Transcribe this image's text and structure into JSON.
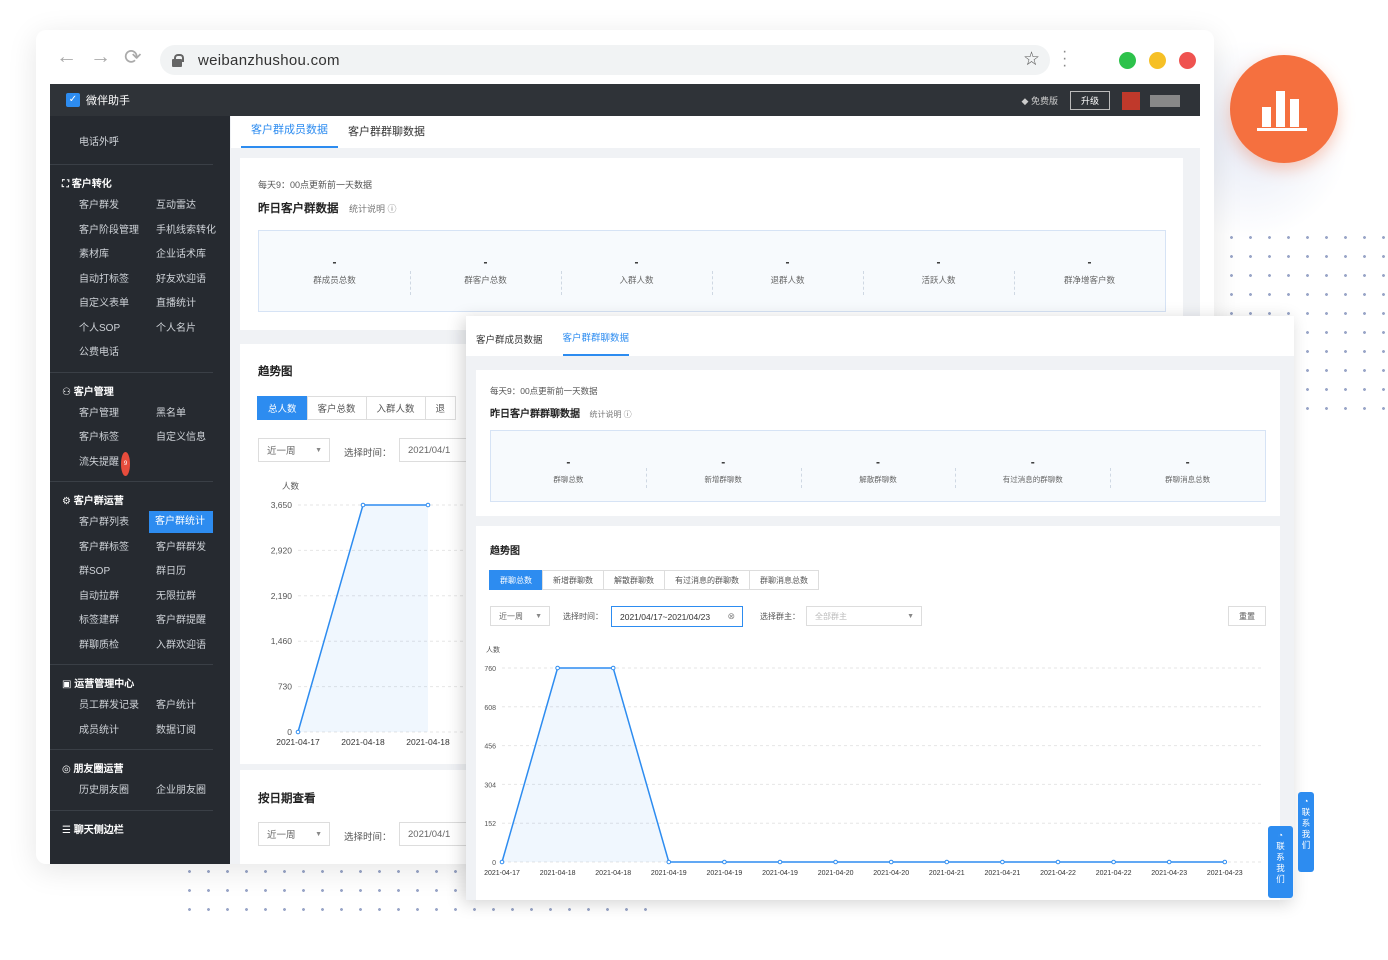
{
  "browser": {
    "url": "weibanzhushou.com",
    "nav_back": "←",
    "nav_forward": "→",
    "nav_reload": "⟳",
    "star": "☆"
  },
  "app": {
    "brand": "微伴助手",
    "free_label": "免费版",
    "upgrade_label": "升级"
  },
  "sidebar": {
    "top_item": "电话外呼",
    "sections": [
      {
        "title": "客户转化",
        "items": [
          "客户群发",
          "互动雷达",
          "客户阶段管理",
          "手机线索转化",
          "素材库",
          "企业话术库",
          "自动打标签",
          "好友欢迎语",
          "自定义表单",
          "直播统计",
          "个人SOP",
          "个人名片",
          "公费电话"
        ]
      },
      {
        "title": "客户管理",
        "items": [
          "客户管理",
          "黑名单",
          "客户标签",
          "自定义信息",
          "流失提醒"
        ],
        "badge": "9"
      },
      {
        "title": "客户群运营",
        "items": [
          "客户群列表",
          "客户群统计",
          "客户群标签",
          "客户群群发",
          "群SOP",
          "群日历",
          "自动拉群",
          "无限拉群",
          "标签建群",
          "客户群提醒",
          "群聊质检",
          "入群欢迎语"
        ],
        "active": "客户群统计"
      },
      {
        "title": "运营管理中心",
        "items": [
          "员工群发记录",
          "客户统计",
          "成员统计",
          "数据订阅"
        ]
      },
      {
        "title": "朋友圈运营",
        "items": [
          "历史朋友圈",
          "企业朋友圈"
        ]
      },
      {
        "title": "聊天侧边栏",
        "items": []
      }
    ]
  },
  "main": {
    "tabs": [
      "客户群成员数据",
      "客户群群聊数据"
    ],
    "update_note": "每天9：00点更新前一天数据",
    "title": "昨日客户群数据",
    "explain": "统计说明",
    "metrics": [
      "群成员总数",
      "群客户总数",
      "入群人数",
      "退群人数",
      "活跃人数",
      "群净增客户数"
    ],
    "metric_value": "-",
    "trend_title": "趋势图",
    "trend_tabs": [
      "总人数",
      "客户总数",
      "入群人数",
      "退"
    ],
    "range_select": "近一周",
    "time_label": "选择时间：",
    "date_value": "2021/04/1",
    "date_section_title": "按日期查看"
  },
  "overlay": {
    "tabs": [
      "客户群成员数据",
      "客户群群聊数据"
    ],
    "update_note": "每天9：00点更新前一天数据",
    "title": "昨日客户群群聊数据",
    "explain": "统计说明",
    "metrics": [
      "群聊总数",
      "新增群聊数",
      "解散群聊数",
      "有过消息的群聊数",
      "群聊消息总数"
    ],
    "metric_value": "-",
    "trend_title": "趋势图",
    "trend_tabs": [
      "群聊总数",
      "新增群聊数",
      "解散群聊数",
      "有过消息的群聊数",
      "群聊消息总数"
    ],
    "range_select": "近一周",
    "time_label": "选择时间：",
    "date_range": "2021/04/17~2021/04/23",
    "owner_label": "选择群主：",
    "owner_placeholder": "全部群主",
    "reset": "重置",
    "contact": "联系我们"
  },
  "chart_data": [
    {
      "type": "area",
      "ylabel": "人数",
      "yticks": [
        0,
        730,
        1460,
        2190,
        2920,
        3650
      ],
      "ylim": [
        0,
        3650
      ],
      "x": [
        "2021-04-17",
        "2021-04-18",
        "2021-04-18"
      ],
      "series": [
        {
          "values": [
            0,
            3650,
            3650
          ]
        }
      ],
      "grid": true
    },
    {
      "type": "area",
      "ylabel": "人数",
      "yticks": [
        0,
        152,
        304,
        456,
        608,
        760
      ],
      "ylim": [
        0,
        760
      ],
      "x": [
        "2021-04-17",
        "2021-04-18",
        "2021-04-18",
        "2021-04-19",
        "2021-04-19",
        "2021-04-19",
        "2021-04-20",
        "2021-04-20",
        "2021-04-21",
        "2021-04-21",
        "2021-04-22",
        "2021-04-22",
        "2021-04-23",
        "2021-04-23"
      ],
      "series": [
        {
          "values": [
            0,
            760,
            760,
            0,
            0,
            0,
            0,
            0,
            0,
            0,
            0,
            0,
            0,
            0
          ]
        }
      ],
      "grid": true
    }
  ]
}
